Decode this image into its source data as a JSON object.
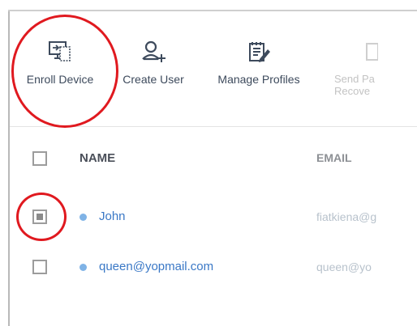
{
  "toolbar": {
    "items": [
      {
        "label": "Enroll Device",
        "icon": "enroll-device-icon"
      },
      {
        "label": "Create User",
        "icon": "create-user-icon"
      },
      {
        "label": "Manage Profiles",
        "icon": "manage-profiles-icon"
      },
      {
        "label_line1": "Send Pa",
        "label_line2": "Recove",
        "icon": "send-password-icon"
      }
    ]
  },
  "table": {
    "columns": [
      "NAME",
      "EMAIL"
    ],
    "rows": [
      {
        "name": "John",
        "email": "fiatkiena@g",
        "checked": true
      },
      {
        "name": "queen@yopmail.com",
        "email": "queen@yo",
        "checked": false
      }
    ]
  },
  "colors": {
    "accent": "#3a78c6",
    "highlight_ring": "#e0191f",
    "status_dot": "#7fb3e6"
  }
}
